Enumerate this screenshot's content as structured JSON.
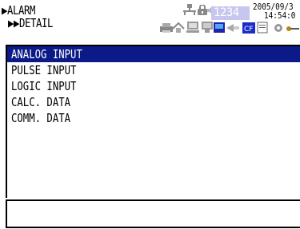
{
  "header": {
    "nav_level1": "ALARM",
    "nav_level2": "DETAIL",
    "counter": "1234",
    "date": "2005/09/3",
    "time": "14:54:0"
  },
  "menu": {
    "items": [
      {
        "label": "ANALOG INPUT",
        "selected": true
      },
      {
        "label": "PULSE INPUT",
        "selected": false
      },
      {
        "label": "LOGIC INPUT",
        "selected": false
      },
      {
        "label": "CALC. DATA",
        "selected": false
      },
      {
        "label": "COMM. DATA",
        "selected": false
      }
    ]
  },
  "message": {
    "text": ""
  },
  "colors": {
    "selection": "#0c1a87",
    "counter_box": "#c6c6ee",
    "background": "#ffffff",
    "text": "#000000"
  },
  "icons": [
    "network-icon",
    "lock-icon",
    "speaker-icon",
    "counter-display",
    "printer-icon",
    "transfer-icon",
    "pc-icon",
    "monitor-icon",
    "memory-card-icon",
    "cf-card-icon",
    "document-icon",
    "key-icon"
  ]
}
